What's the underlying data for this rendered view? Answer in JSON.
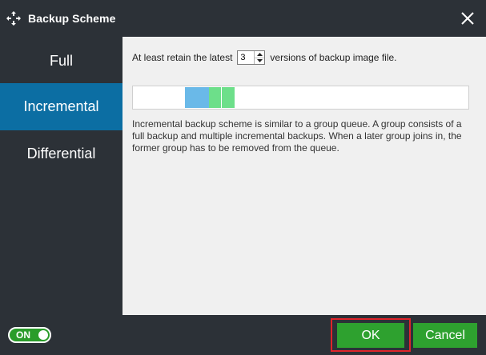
{
  "window": {
    "title": "Backup Scheme",
    "app_icon": "backup-arrows-icon",
    "close_icon": "close-icon"
  },
  "tabs": [
    {
      "label": "Full",
      "selected": false
    },
    {
      "label": "Incremental",
      "selected": true
    },
    {
      "label": "Differential",
      "selected": false
    }
  ],
  "content": {
    "retain_prefix": "At least retain the latest",
    "retain_value": "3",
    "retain_suffix": "versions of backup image file.",
    "description": "Incremental backup scheme is similar to a group queue. A group consists of a full backup and multiple incremental backups. When a later group joins in, the former group has to be removed from the queue."
  },
  "footer": {
    "toggle_label": "ON",
    "toggle_on": true,
    "ok_label": "OK",
    "cancel_label": "Cancel"
  },
  "colors": {
    "selected_tab": "#0c6ea3",
    "button_green": "#2ea12f",
    "full_block": "#6ab9e8",
    "incremental_block": "#6ddf8a",
    "highlight": "#e0242a"
  }
}
